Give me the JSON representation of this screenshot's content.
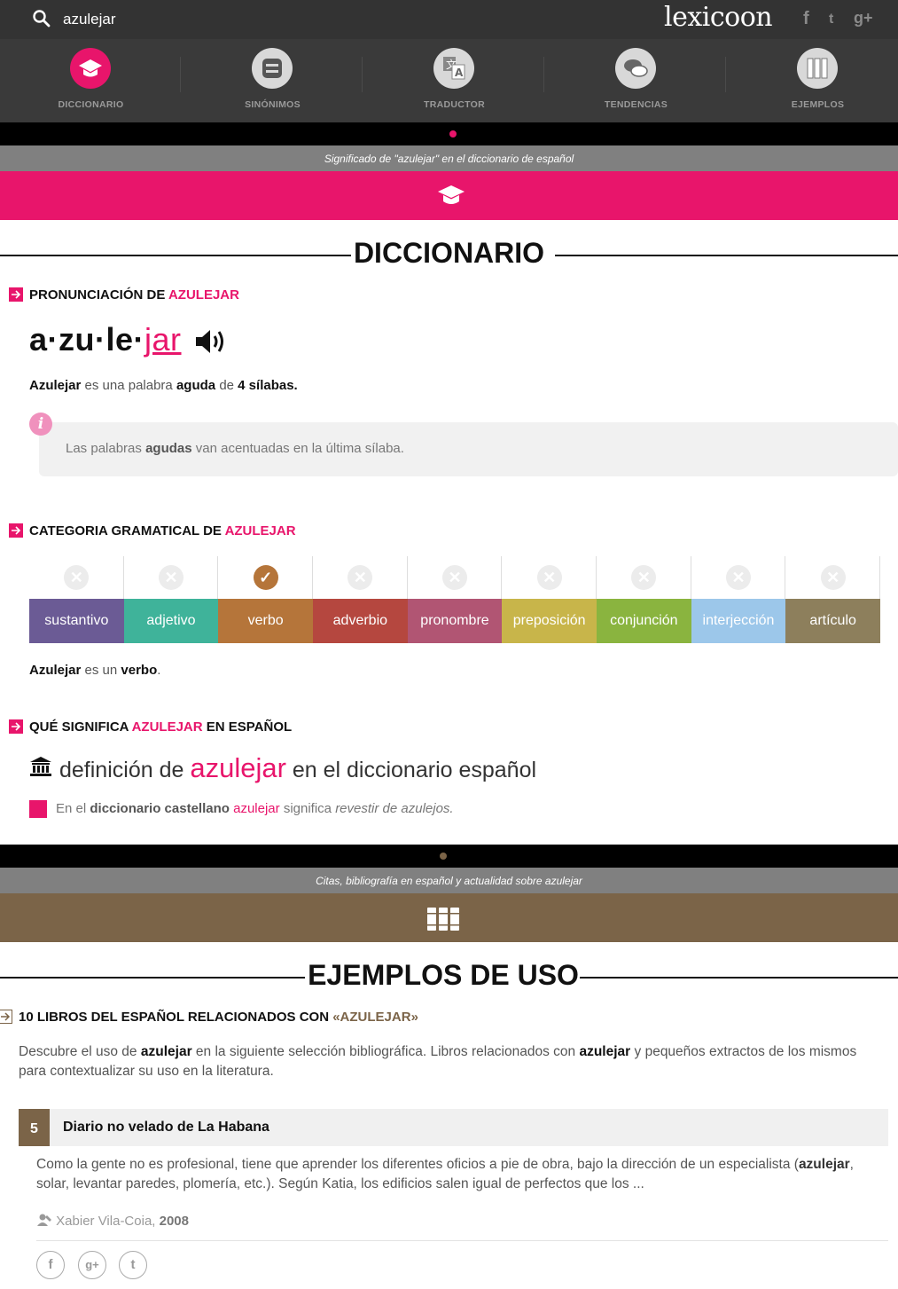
{
  "search": {
    "query": "azulejar"
  },
  "logo": "lexicoon",
  "social_top": [
    "f",
    "t",
    "g+"
  ],
  "nav": [
    {
      "label": "DICCIONARIO",
      "icon": "graduation-cap-icon",
      "active": true
    },
    {
      "label": "SINÓNIMOS",
      "icon": "equals-icon",
      "active": false
    },
    {
      "label": "TRADUCTOR",
      "icon": "translate-icon",
      "active": false
    },
    {
      "label": "TENDENCIAS",
      "icon": "chat-bubbles-icon",
      "active": false
    },
    {
      "label": "EJEMPLOS",
      "icon": "books-icon",
      "active": false
    }
  ],
  "dict_band": {
    "subtitle": "Significado de \"azulejar\" en el diccionario de español",
    "color": "#e8156b"
  },
  "dict_title": "DICCIONARIO",
  "pron": {
    "heading_prefix": "PRONUNCIACIÓN DE",
    "heading_word": "AZULEJAR",
    "syllables_plain": "a·zu·le·",
    "syllables_stressed": "jar",
    "summary_word": "Azulejar",
    "summary_mid1": "es una palabra",
    "summary_type": "aguda",
    "summary_mid2": "de",
    "summary_count": "4 sílabas.",
    "info_pre": "Las palabras",
    "info_bold": "agudas",
    "info_post": "van acentuadas en la última sílaba."
  },
  "cat": {
    "heading_prefix": "CATEGORIA GRAMATICAL DE",
    "heading_word": "AZULEJAR",
    "items": [
      {
        "label": "sustantivo",
        "color": "#6b5b95",
        "checked": false
      },
      {
        "label": "adjetivo",
        "color": "#3fb39a",
        "checked": false
      },
      {
        "label": "verbo",
        "color": "#b5753a",
        "checked": true
      },
      {
        "label": "adverbio",
        "color": "#b5473f",
        "checked": false
      },
      {
        "label": "pronombre",
        "color": "#b15573",
        "checked": false
      },
      {
        "label": "preposición",
        "color": "#c8b54a",
        "checked": false
      },
      {
        "label": "conjunción",
        "color": "#8ab43f",
        "checked": false
      },
      {
        "label": "interjección",
        "color": "#9cc7ea",
        "checked": false
      },
      {
        "label": "artículo",
        "color": "#8d7f5c",
        "checked": false
      }
    ],
    "summary_word": "Azulejar",
    "summary_mid": "es un",
    "summary_cat": "verbo",
    "summary_end": "."
  },
  "meaning": {
    "heading_prefix": "QUÉ SIGNIFICA",
    "heading_word": "AZULEJAR",
    "heading_suffix": "EN ESPAÑOL",
    "def_pre": "definición de",
    "def_word": "azulejar",
    "def_post": "en el diccionario español",
    "text_pre": "En el",
    "text_bold": "diccionario castellano",
    "text_word": "azulejar",
    "text_mid": "significa",
    "text_def": "revestir de azulejos."
  },
  "examples_band": {
    "subtitle": "Citas, bibliografía en español y actualidad sobre azulejar",
    "color": "#7b6448"
  },
  "examples_title": "EJEMPLOS DE USO",
  "books": {
    "heading_prefix": "10 LIBROS DEL ESPAÑOL RELACIONADOS CON",
    "heading_word": "«AZULEJAR»",
    "intro_1": "Descubre el uso de",
    "intro_w1": "azulejar",
    "intro_2": "en la siguiente selección bibliográfica. Libros relacionados con",
    "intro_w2": "azulejar",
    "intro_3": "y pequeños extractos de los mismos para contextualizar su uso en la literatura.",
    "item": {
      "number": "5",
      "title": "Diario no velado de La Habana",
      "excerpt_1": "Como la gente no es profesional, tiene que aprender los diferentes oficios a pie de obra, bajo la dirección de un especialista (",
      "excerpt_w": "azulejar",
      "excerpt_2": ", solar, levantar paredes, plomería, etc.). Según Katia, los edificios salen igual de perfectos que los ...",
      "author": "Xabier Vila-Coia,",
      "year": "2008"
    },
    "share": [
      "f",
      "g+",
      "t"
    ]
  }
}
